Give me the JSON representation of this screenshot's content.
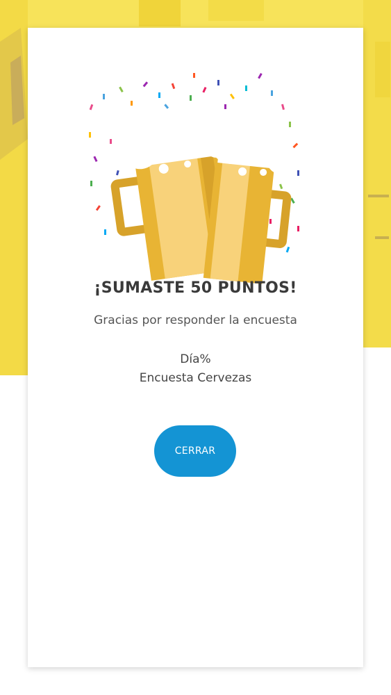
{
  "colors": {
    "background_yellow": "#f6e04f",
    "accent_blue": "#1494d4",
    "beer_gold": "#e8b434",
    "foam_white": "#ffffff"
  },
  "dialog": {
    "icon": "beer-toast-icon",
    "title": "¡SUMASTE 50 PUNTOS!",
    "subtitle": "Gracias por responder la encuesta",
    "brand": "Día%",
    "survey_name": "Encuesta Cervezas",
    "close_label": "CERRAR"
  }
}
